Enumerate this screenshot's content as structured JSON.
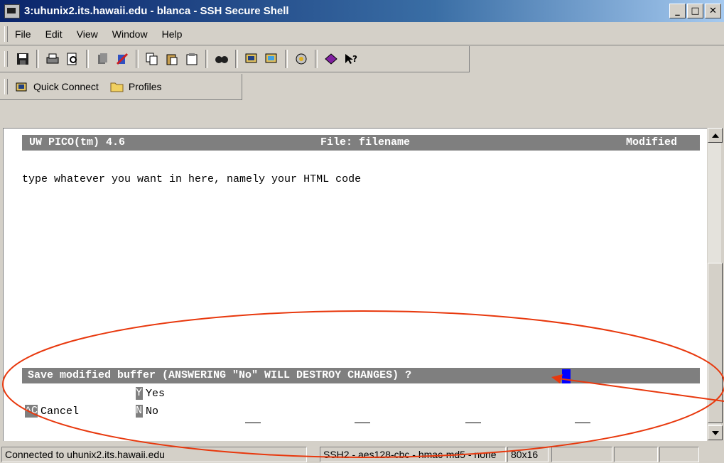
{
  "window": {
    "title": "3:uhunix2.its.hawaii.edu - blanca - SSH Secure Shell",
    "minimize": "_",
    "maximize": "□",
    "close": "✕"
  },
  "menu": [
    "File",
    "Edit",
    "View",
    "Window",
    "Help"
  ],
  "toolbar_icons": [
    "save-icon",
    "print-icon",
    "print-preview-icon",
    "key-icon",
    "settings-icon",
    "copy-icon",
    "paste-icon",
    "paste-alt-icon",
    "find-icon",
    "new-terminal-icon",
    "new-file-transfer-icon",
    "sftp-settings-icon",
    "help-book-icon",
    "context-help-icon"
  ],
  "quick_connect": {
    "label": "Quick Connect",
    "profiles": "Profiles"
  },
  "editor": {
    "app": "UW PICO(tm) 4.6",
    "file": "File: filename",
    "state": "Modified",
    "body": "type whatever you want in here, namely your HTML code",
    "prompt": "Save modified buffer (ANSWERING \"No\" WILL DESTROY CHANGES) ?",
    "options": [
      {
        "key": "Y",
        "label": "Yes"
      },
      {
        "key": "^C",
        "label": "Cancel"
      },
      {
        "key": "N",
        "label": "No"
      }
    ]
  },
  "statusbar": {
    "connection": "Connected to uhunix2.its.hawaii.edu",
    "cipher": "SSH2 - aes128-cbc - hmac-md5 - none",
    "size": "80x16"
  },
  "colors": {
    "title_blue": "#0a246a",
    "annotation": "#e8380d",
    "cursor": "#0000ff"
  }
}
